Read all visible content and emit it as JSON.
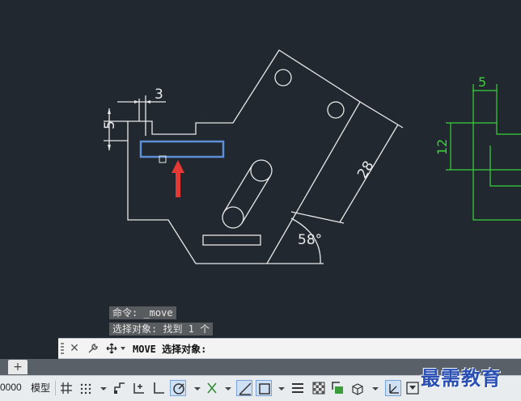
{
  "drawing": {
    "dims": {
      "gap_width": "3",
      "gap_height": "5",
      "slant_length": "28",
      "angle": "58°",
      "right_width": "5",
      "right_height": "12"
    }
  },
  "history": [
    "命令: _move",
    "选择对象: 找到 1 个"
  ],
  "command_line": {
    "text": "MOVE 选择对象:"
  },
  "statusbar": {
    "coords": "0000",
    "model_label": "模型"
  },
  "watermark": "最需教育",
  "colors": {
    "background": "#212830",
    "lines": "#e8e8e8",
    "highlight": "#5b8fd6",
    "arrow": "#e53935",
    "green_dims": "#3bd13b"
  }
}
